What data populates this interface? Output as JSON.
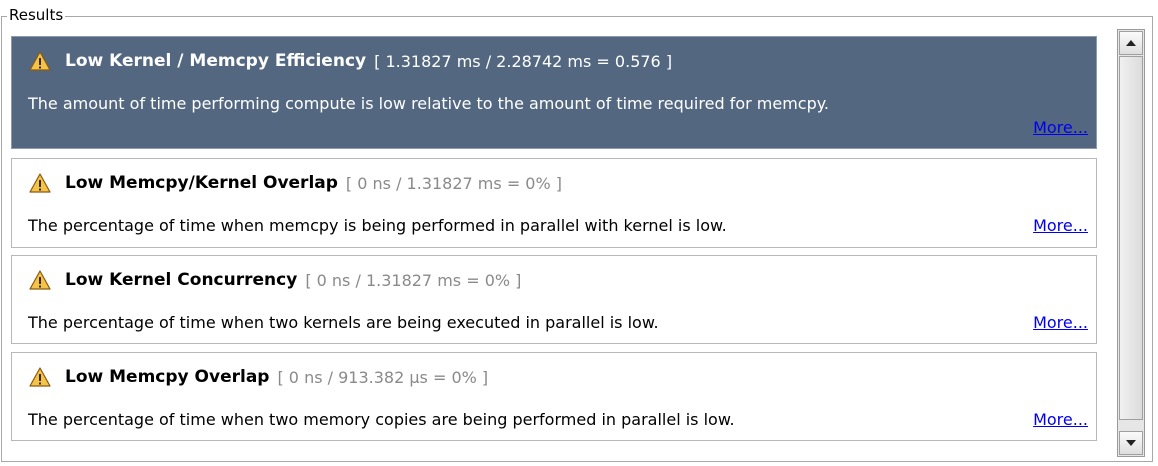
{
  "group": {
    "title": "Results"
  },
  "results": [
    {
      "title": "Low Kernel / Memcpy Efficiency",
      "metric": "[ 1.31827 ms / 2.28742 ms = 0.576 ]",
      "description": "The amount of time performing compute is low relative to the amount of time required for memcpy.",
      "more": "More...",
      "selected": true
    },
    {
      "title": "Low Memcpy/Kernel Overlap",
      "metric": "[ 0 ns / 1.31827 ms = 0% ]",
      "description": "The percentage of time when memcpy is being performed in parallel with kernel is low.",
      "more": "More...",
      "selected": false
    },
    {
      "title": "Low Kernel Concurrency",
      "metric": "[ 0 ns / 1.31827 ms = 0% ]",
      "description": "The percentage of time when two kernels are being executed in parallel is low.",
      "more": "More...",
      "selected": false
    },
    {
      "title": "Low Memcpy Overlap",
      "metric": "[ 0 ns / 913.382 μs = 0% ]",
      "description": "The percentage of time when two memory copies are being performed in parallel is low.",
      "more": "More...",
      "selected": false
    }
  ],
  "scrollbar": {
    "up_icon": "arrow-up-icon",
    "down_icon": "arrow-down-icon"
  },
  "colors": {
    "selected_bg": "#536880",
    "link": "#0000ee",
    "warning": "#f0b030"
  }
}
